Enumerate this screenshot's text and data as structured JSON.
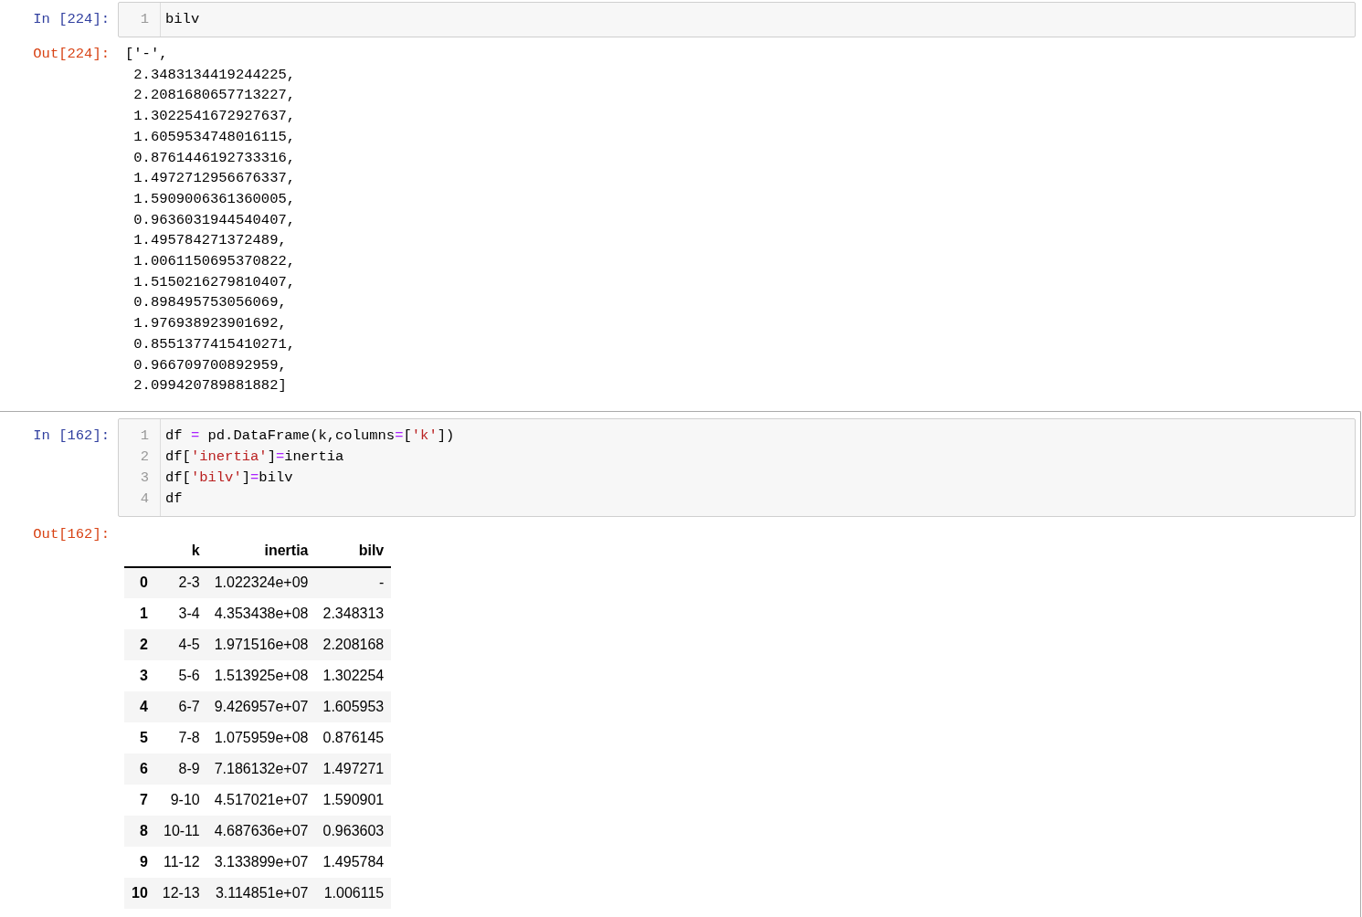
{
  "notebook": {
    "cells": [
      {
        "selected": false,
        "input": {
          "prompt": "In [224]:",
          "lines": [
            {
              "number": "1",
              "tokens": [
                {
                  "text": "bilv",
                  "kind": "plain"
                }
              ]
            }
          ]
        },
        "output": {
          "prompt": "Out[224]:",
          "kind": "text",
          "lines": [
            "['-',",
            " 2.3483134419244225,",
            " 2.2081680657713227,",
            " 1.3022541672927637,",
            " 1.6059534748016115,",
            " 0.8761446192733316,",
            " 1.4972712956676337,",
            " 1.5909006361360005,",
            " 0.9636031944540407,",
            " 1.495784271372489,",
            " 1.0061150695370822,",
            " 1.5150216279810407,",
            " 0.898495753056069,",
            " 1.976938923901692,",
            " 0.8551377415410271,",
            " 0.966709700892959,",
            " 2.099420789881882]"
          ]
        }
      },
      {
        "selected": true,
        "input": {
          "prompt": "In [162]:",
          "lines": [
            {
              "number": "1",
              "tokens": [
                {
                  "text": "df ",
                  "kind": "plain"
                },
                {
                  "text": "=",
                  "kind": "operator"
                },
                {
                  "text": " pd.DataFrame(k,columns",
                  "kind": "plain"
                },
                {
                  "text": "=",
                  "kind": "operator"
                },
                {
                  "text": "[",
                  "kind": "plain"
                },
                {
                  "text": "'k'",
                  "kind": "string"
                },
                {
                  "text": "])",
                  "kind": "plain"
                }
              ]
            },
            {
              "number": "2",
              "tokens": [
                {
                  "text": "df[",
                  "kind": "plain"
                },
                {
                  "text": "'inertia'",
                  "kind": "string"
                },
                {
                  "text": "]",
                  "kind": "plain"
                },
                {
                  "text": "=",
                  "kind": "operator"
                },
                {
                  "text": "inertia",
                  "kind": "plain"
                }
              ]
            },
            {
              "number": "3",
              "tokens": [
                {
                  "text": "df[",
                  "kind": "plain"
                },
                {
                  "text": "'bilv'",
                  "kind": "string"
                },
                {
                  "text": "]",
                  "kind": "plain"
                },
                {
                  "text": "=",
                  "kind": "operator"
                },
                {
                  "text": "bilv",
                  "kind": "plain"
                }
              ]
            },
            {
              "number": "4",
              "tokens": [
                {
                  "text": "df",
                  "kind": "plain"
                }
              ]
            }
          ]
        },
        "output": {
          "prompt": "Out[162]:",
          "kind": "table",
          "table": {
            "columns": [
              "k",
              "inertia",
              "bilv"
            ],
            "rows": [
              {
                "index": "0",
                "cells": [
                  "2-3",
                  "1.022324e+09",
                  "-"
                ]
              },
              {
                "index": "1",
                "cells": [
                  "3-4",
                  "4.353438e+08",
                  "2.348313"
                ]
              },
              {
                "index": "2",
                "cells": [
                  "4-5",
                  "1.971516e+08",
                  "2.208168"
                ]
              },
              {
                "index": "3",
                "cells": [
                  "5-6",
                  "1.513925e+08",
                  "1.302254"
                ]
              },
              {
                "index": "4",
                "cells": [
                  "6-7",
                  "9.426957e+07",
                  "1.605953"
                ]
              },
              {
                "index": "5",
                "cells": [
                  "7-8",
                  "1.075959e+08",
                  "0.876145"
                ]
              },
              {
                "index": "6",
                "cells": [
                  "8-9",
                  "7.186132e+07",
                  "1.497271"
                ]
              },
              {
                "index": "7",
                "cells": [
                  "9-10",
                  "4.517021e+07",
                  "1.590901"
                ]
              },
              {
                "index": "8",
                "cells": [
                  "10-11",
                  "4.687636e+07",
                  "0.963603"
                ]
              },
              {
                "index": "9",
                "cells": [
                  "11-12",
                  "3.133899e+07",
                  "1.495784"
                ]
              },
              {
                "index": "10",
                "cells": [
                  "12-13",
                  "3.114851e+07",
                  "1.006115"
                ]
              }
            ]
          }
        }
      }
    ]
  }
}
